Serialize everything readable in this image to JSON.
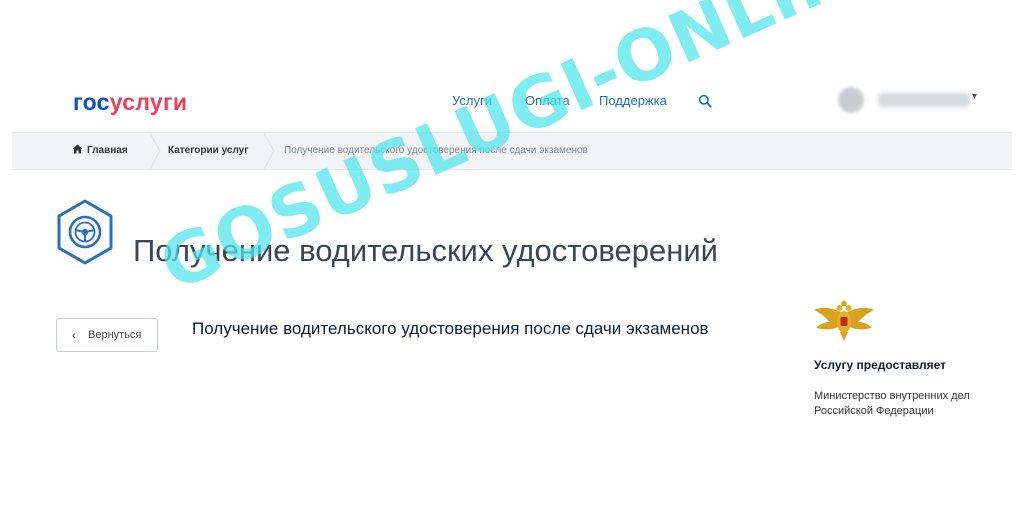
{
  "header": {
    "logo_part1": "гос",
    "logo_part2": "услуги",
    "nav": [
      {
        "label": "Услуги"
      },
      {
        "label": "Оплата"
      },
      {
        "label": "Поддержка"
      }
    ],
    "search_icon": "search-icon",
    "user_menu_caret": "▾"
  },
  "breadcrumb": {
    "home": "Главная",
    "category": "Категории услуг",
    "current": "Получение водительского удостоверения после сдачи экзаменов"
  },
  "page": {
    "title": "Получение водительских удостоверений",
    "icon": "steering-wheel-icon"
  },
  "back_button": {
    "chevron": "‹",
    "label": "Вернуться"
  },
  "service": {
    "title": "Получение водительского удостоверения после сдачи экзаменов"
  },
  "provider": {
    "label": "Услугу предоставляет",
    "name": "Министерство внутренних дел Российской Федерации",
    "emblem": "mvd-emblem-icon"
  },
  "watermark": "GOSUSLUGI-ONLINE.RU",
  "colors": {
    "brand_blue": "#0d4cd3",
    "brand_red": "#ee3f58",
    "link": "#1f6fbf",
    "icon_blue": "#2a70b8",
    "watermark": "#4fe6ee"
  }
}
